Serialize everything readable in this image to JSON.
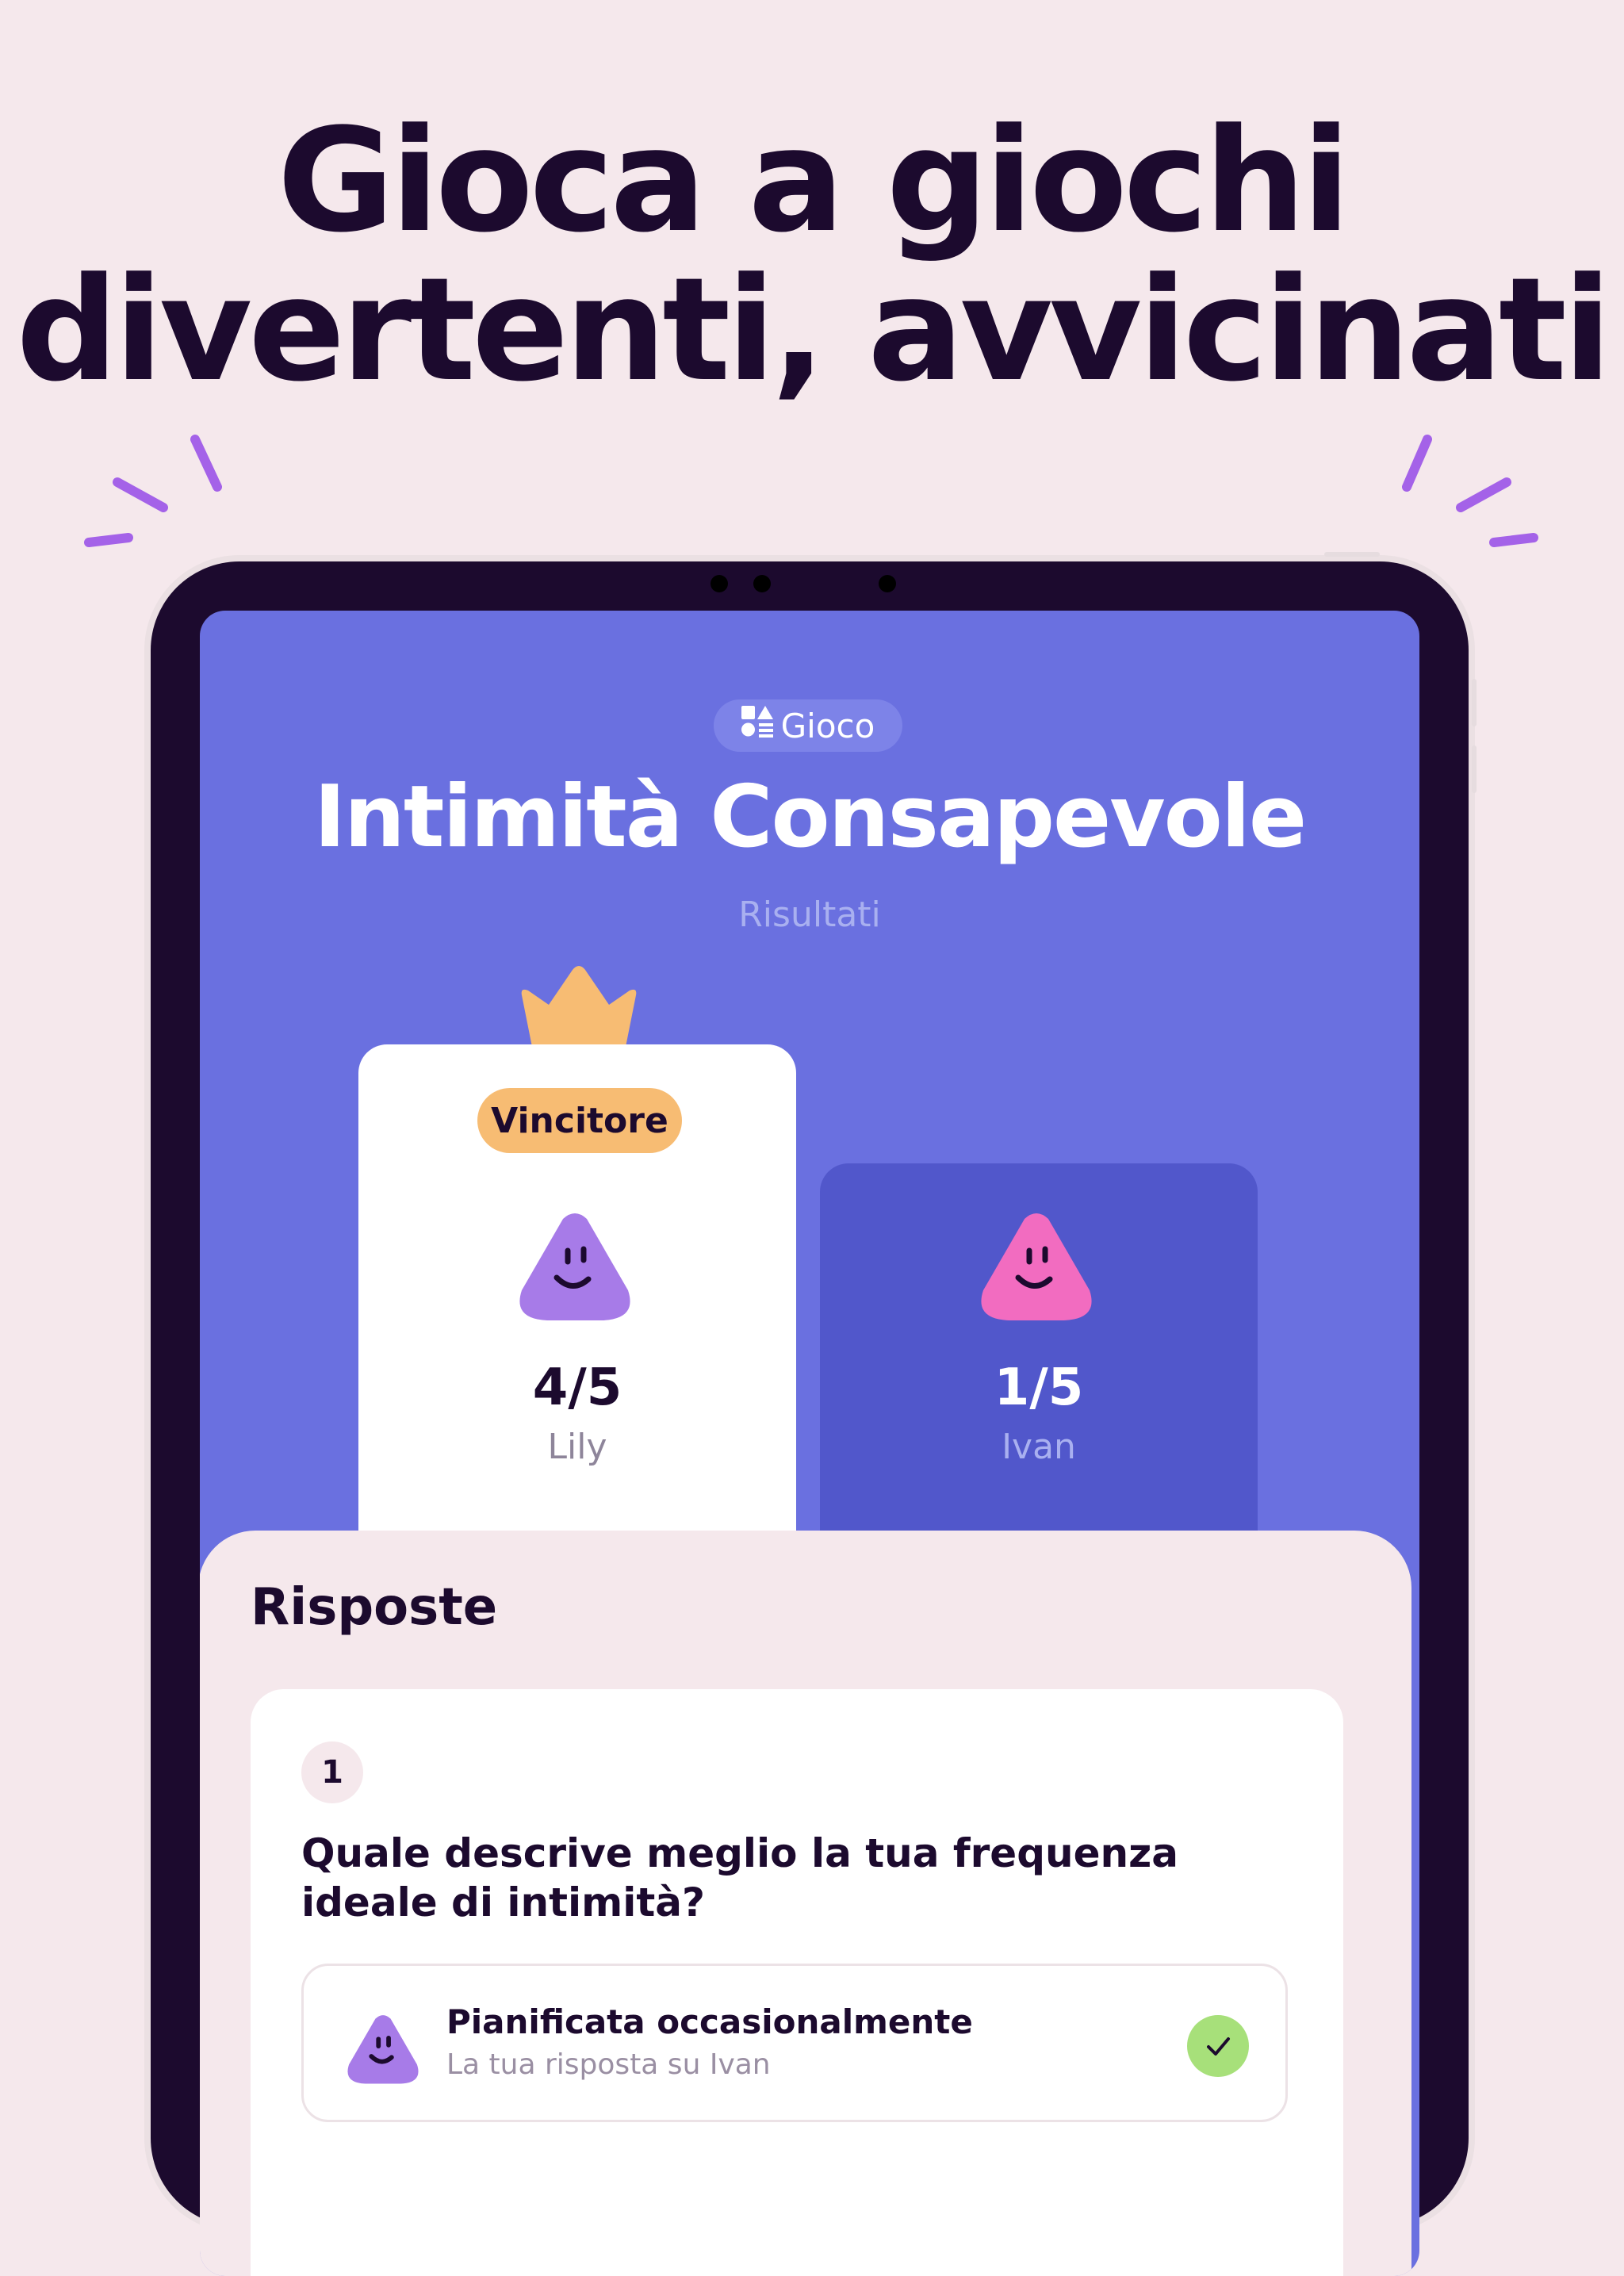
{
  "headline": {
    "line1": "Gioca a giochi",
    "line2": "divertenti, avvicinati"
  },
  "colors": {
    "background": "#f5e8ec",
    "screen": "#6a70e0",
    "winner_badge": "#f7bc73",
    "accent_purple": "#a77be8",
    "accent_pink": "#f26cc0",
    "correct": "#a7e07a"
  },
  "game": {
    "chip_icon": "game-shapes-icon",
    "chip_label": "Gioco",
    "title": "Intimità Consapevole",
    "subtitle": "Risultati"
  },
  "results": {
    "winner": {
      "badge": "Vincitore",
      "score": "4/5",
      "name": "Lily",
      "avatar": "purple-smiley-avatar"
    },
    "other": {
      "score": "1/5",
      "name": "Ivan",
      "avatar": "pink-smiley-avatar"
    }
  },
  "answers": {
    "title": "Risposte",
    "questions": [
      {
        "number": "1",
        "text": "Quale descrive meglio la tua frequenza ideale di intimità?",
        "answer_title": "Pianificata occasionalmente",
        "answer_subtitle": "La tua risposta su Ivan",
        "status_icon": "check-icon"
      }
    ]
  }
}
